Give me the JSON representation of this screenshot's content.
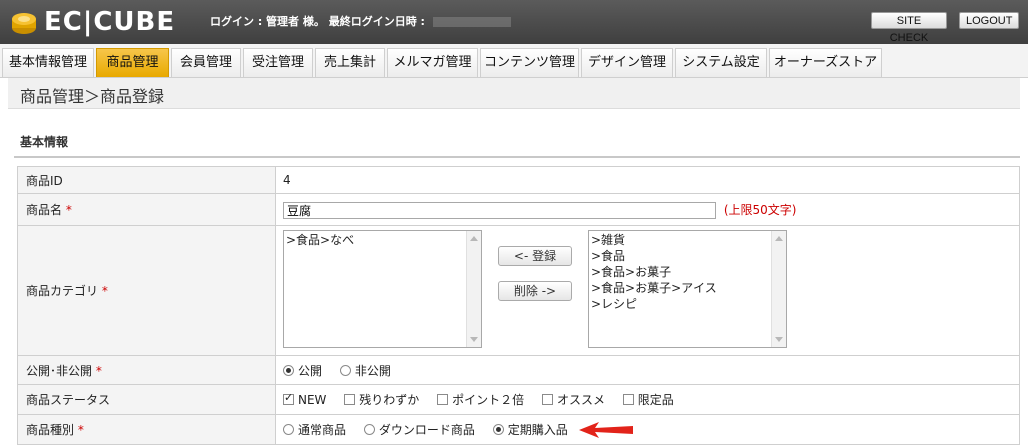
{
  "header": {
    "logo_text": "EC|CUBE",
    "login_text": "ログイン : 管理者 様。 最終ログイン日時 :",
    "site_check": "SITE CHECK",
    "logout": "LOGOUT"
  },
  "nav": {
    "items": [
      {
        "label": "基本情報管理"
      },
      {
        "label": "商品管理"
      },
      {
        "label": "会員管理"
      },
      {
        "label": "受注管理"
      },
      {
        "label": "売上集計"
      },
      {
        "label": "メルマガ管理"
      },
      {
        "label": "コンテンツ管理"
      },
      {
        "label": "デザイン管理"
      },
      {
        "label": "システム設定"
      },
      {
        "label": "オーナーズストア"
      }
    ],
    "active_index": 1
  },
  "page": {
    "title": "商品管理＞商品登録",
    "section_title": "基本情報"
  },
  "form": {
    "product_id_label": "商品ID",
    "product_id_value": "4",
    "product_name_label": "商品名",
    "product_name_value": "豆腐",
    "product_name_limit": "(上限50文字)",
    "category_label": "商品カテゴリ",
    "category_selected": [
      ">食品>なべ"
    ],
    "category_available": [
      ">雑貨",
      ">食品",
      ">食品>お菓子",
      ">食品>お菓子>アイス",
      ">レシピ"
    ],
    "btn_register": "<- 登録",
    "btn_delete": "削除 ->",
    "publish_label": "公開･非公開",
    "publish_options": [
      {
        "label": "公開",
        "checked": true
      },
      {
        "label": "非公開",
        "checked": false
      }
    ],
    "status_label": "商品ステータス",
    "status_options": [
      {
        "label": "NEW",
        "checked": true
      },
      {
        "label": "残りわずか",
        "checked": false
      },
      {
        "label": "ポイント２倍",
        "checked": false
      },
      {
        "label": "オススメ",
        "checked": false
      },
      {
        "label": "限定品",
        "checked": false
      }
    ],
    "type_label": "商品種別",
    "type_options": [
      {
        "label": "通常商品",
        "checked": false
      },
      {
        "label": "ダウンロード商品",
        "checked": false
      },
      {
        "label": "定期購入品",
        "checked": true
      }
    ],
    "required_mark": "*"
  },
  "colors": {
    "accent": "#f0b400",
    "required": "#cc0000",
    "arrow": "#e2231a"
  }
}
